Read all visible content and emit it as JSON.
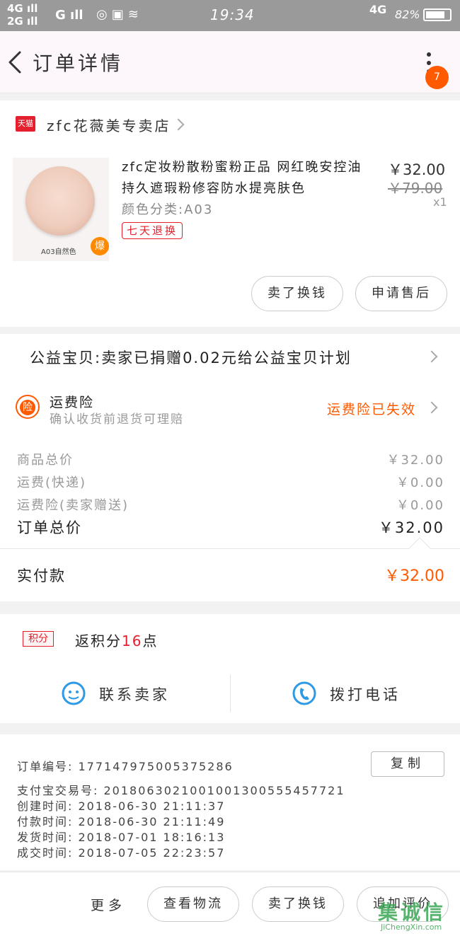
{
  "status_bar": {
    "signal_left": "4G ıll\n2G ıll",
    "signal_g": "G ıll",
    "time": "19:34",
    "right_network": "4G",
    "battery": "82%"
  },
  "header": {
    "title": "订单详情",
    "badge_count": "7"
  },
  "shop": {
    "logo_text": "天猫",
    "name": "zfc花薇美专卖店"
  },
  "product": {
    "title": "zfc定妆粉散粉蜜粉正品 网红晚安控油持久遮瑕粉修容防水提亮肤色",
    "sku": "颜色分类:A03",
    "tag": "七天退换",
    "price": "￥32.00",
    "original_price": "￥79.00",
    "qty": "x1",
    "thumb_label": "A03自然色",
    "hot_badge": "爆",
    "btn_exchange": "卖了换钱",
    "btn_after_sale": "申请售后"
  },
  "charity": {
    "text": "公益宝贝:卖家已捐赠0.02元给公益宝贝计划"
  },
  "insurance": {
    "icon_text": "险",
    "title": "运费险",
    "desc": "确认收货前退货可理赔",
    "status": "运费险已失效"
  },
  "fees": {
    "rows": [
      {
        "label": "商品总价",
        "value": "￥32.00"
      },
      {
        "label": "运费(快递)",
        "value": "￥0.00"
      },
      {
        "label": "运费险(卖家赠送)",
        "value": "￥0.00"
      }
    ],
    "total_label": "订单总价",
    "total_value": "￥32.00"
  },
  "paid": {
    "label": "实付款",
    "value": "￥32.00"
  },
  "points": {
    "badge": "积分",
    "prefix": "返积分",
    "num": "16",
    "suffix": "点"
  },
  "contact": {
    "seller": "联系卖家",
    "call": "拨打电话"
  },
  "order_info": {
    "copy_label": "复制",
    "lines": [
      "订单编号:  1771479750053752​86",
      "支付宝交易号:  2018063021001001300555457721",
      "创建时间:  2018-06-30  21:11:37",
      "付款时间:  2018-06-30  21:11:49",
      "发货时间:  2018-07-01  18:16:13",
      "成交时间:  2018-07-05  22:23:57"
    ]
  },
  "footer": {
    "more": "更多",
    "logistics": "查看物流",
    "sell": "卖了换钱",
    "review": "追加评价"
  },
  "watermark": {
    "main": "集诚信",
    "sub": "JiChengXin.com"
  }
}
